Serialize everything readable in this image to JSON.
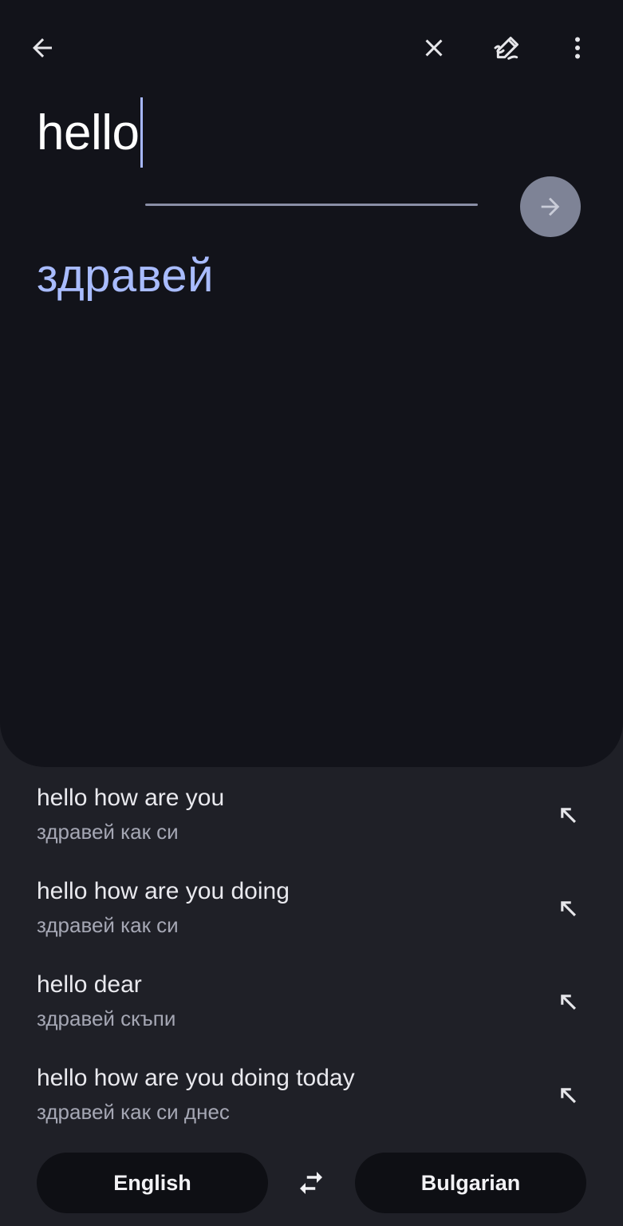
{
  "input": {
    "text": "hello"
  },
  "output": {
    "translation": "здравей"
  },
  "suggestions": [
    {
      "source": "hello how are you",
      "translation": "здравей как си"
    },
    {
      "source": "hello how are you doing",
      "translation": "здравей как си"
    },
    {
      "source": "hello dear",
      "translation": "здравей скъпи"
    },
    {
      "source": "hello how are you doing today",
      "translation": "здравей как си днес"
    }
  ],
  "languages": {
    "source": "English",
    "target": "Bulgarian"
  },
  "icons": {
    "back": "arrow-left-icon",
    "clear": "close-icon",
    "handwriting": "handwriting-pen-icon",
    "more": "more-vert-icon",
    "translate": "arrow-right-icon",
    "insert": "arrow-up-left-icon",
    "swap": "swap-horiz-icon"
  },
  "colors": {
    "background": "#12131a",
    "panel": "#1f2027",
    "accent": "#a9bcff",
    "caret": "#a7b7ff"
  }
}
